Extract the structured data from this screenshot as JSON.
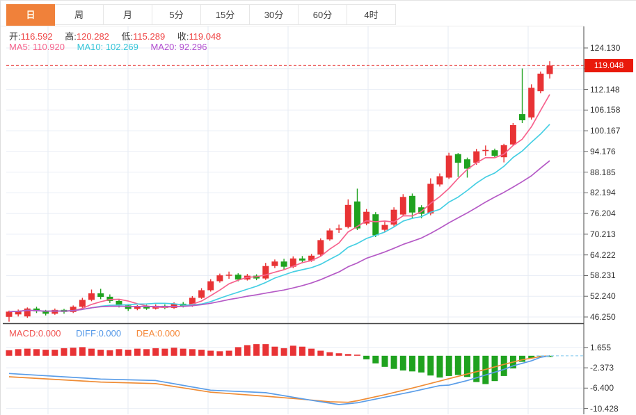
{
  "tabs": [
    {
      "label": "日",
      "active": true
    },
    {
      "label": "周",
      "active": false
    },
    {
      "label": "月",
      "active": false
    },
    {
      "label": "5分",
      "active": false
    },
    {
      "label": "15分",
      "active": false
    },
    {
      "label": "30分",
      "active": false
    },
    {
      "label": "60分",
      "active": false
    },
    {
      "label": "4时",
      "active": false
    }
  ],
  "ohlc": {
    "open_label": "开:",
    "open": "116.592",
    "high_label": "高:",
    "high": "120.282",
    "low_label": "低:",
    "low": "115.289",
    "close_label": "收:",
    "close": "119.048"
  },
  "ma_header": {
    "ma5_label": "MA5:",
    "ma5": "110.920",
    "ma10_label": "MA10:",
    "ma10": "102.269",
    "ma20_label": "MA20:",
    "ma20": "92.296"
  },
  "macd_header": {
    "macd_label": "MACD:",
    "macd": "0.000",
    "diff_label": "DIFF:",
    "diff": "0.000",
    "dea_label": "DEA:",
    "dea": "0.000"
  },
  "price_axis": {
    "tick_labels": [
      "124.130",
      "112.148",
      "106.158",
      "100.167",
      "94.176",
      "88.185",
      "82.194",
      "76.204",
      "70.213",
      "64.222",
      "58.231",
      "52.240",
      "46.250"
    ],
    "gridline_values": [
      124.13,
      118.139,
      112.148,
      106.158,
      100.167,
      94.176,
      88.185,
      82.194,
      76.204,
      70.213,
      64.222,
      58.231,
      52.24,
      46.25
    ],
    "current_price": "119.048",
    "current_price_value": 119.048
  },
  "macd_axis": {
    "tick_labels": [
      "1.655",
      "-2.373",
      "-6.400",
      "-10.428"
    ],
    "tick_values": [
      1.655,
      -2.373,
      -6.4,
      -10.428
    ]
  },
  "colors": {
    "up": "#e83335",
    "down": "#1fa21f",
    "badge": "#e9190b",
    "tab_active": "#f0813a",
    "ma5": "#f7638e",
    "ma10": "#46cfe3",
    "ma20": "#b55ac6",
    "diff": "#5a9de8",
    "dea": "#ef8c35",
    "grid": "#e9eef6",
    "vgrid": "#e6ebf3",
    "axis": "#666666",
    "separator": "#444444",
    "zero_dash": "#9fd5f2",
    "price_dash": "#e84040"
  },
  "chart_data": {
    "type": "candlestick",
    "title": "Daily candlestick chart with MA5/MA10/MA20 overlays and MACD sub-panel",
    "price_range": [
      46.25,
      124.13
    ],
    "macd_range": [
      -10.428,
      1.655
    ],
    "legend": [
      "MA5",
      "MA10",
      "MA20",
      "MACD",
      "DIFF",
      "DEA"
    ],
    "candles_format": [
      "open",
      "close",
      "low",
      "high"
    ],
    "candles": [
      [
        46.3,
        47.8,
        44.9,
        48.1
      ],
      [
        47.0,
        48.0,
        46.4,
        48.4
      ],
      [
        46.4,
        48.7,
        46.0,
        49.0
      ],
      [
        48.7,
        47.9,
        47.4,
        49.2
      ],
      [
        47.9,
        47.2,
        46.7,
        48.3
      ],
      [
        47.2,
        48.3,
        46.9,
        48.7
      ],
      [
        48.3,
        47.7,
        47.2,
        48.6
      ],
      [
        47.7,
        49.2,
        47.4,
        49.6
      ],
      [
        49.2,
        51.2,
        48.9,
        51.8
      ],
      [
        51.2,
        53.1,
        50.8,
        54.2
      ],
      [
        53.1,
        52.1,
        51.4,
        54.4
      ],
      [
        52.1,
        50.9,
        50.3,
        52.8
      ],
      [
        50.9,
        49.6,
        49.0,
        51.3
      ],
      [
        49.6,
        48.6,
        48.0,
        50.0
      ],
      [
        48.6,
        49.3,
        48.2,
        49.7
      ],
      [
        49.3,
        48.7,
        48.3,
        49.8
      ],
      [
        48.7,
        49.5,
        48.4,
        49.9
      ],
      [
        49.5,
        48.9,
        48.5,
        49.9
      ],
      [
        48.9,
        50.1,
        48.6,
        50.5
      ],
      [
        50.1,
        49.5,
        49.0,
        50.6
      ],
      [
        49.5,
        51.8,
        49.2,
        52.3
      ],
      [
        51.8,
        54.0,
        51.5,
        54.6
      ],
      [
        54.0,
        56.6,
        53.6,
        57.2
      ],
      [
        56.6,
        58.3,
        56.2,
        58.8
      ],
      [
        58.3,
        58.5,
        57.3,
        59.4
      ],
      [
        58.5,
        57.1,
        56.6,
        58.9
      ],
      [
        57.1,
        58.2,
        56.8,
        58.7
      ],
      [
        58.2,
        57.4,
        56.9,
        58.6
      ],
      [
        57.4,
        61.0,
        57.0,
        61.9
      ],
      [
        61.0,
        62.3,
        60.4,
        62.9
      ],
      [
        62.3,
        60.8,
        60.0,
        63.1
      ],
      [
        60.8,
        63.2,
        60.4,
        63.8
      ],
      [
        63.2,
        62.6,
        61.8,
        63.9
      ],
      [
        62.6,
        64.0,
        62.2,
        64.5
      ],
      [
        64.3,
        68.5,
        63.9,
        69.0
      ],
      [
        68.7,
        71.3,
        68.3,
        71.9
      ],
      [
        71.5,
        71.9,
        70.6,
        73.0
      ],
      [
        72.3,
        78.7,
        71.9,
        80.3
      ],
      [
        79.7,
        71.9,
        71.4,
        83.4
      ],
      [
        73.3,
        76.7,
        72.8,
        77.5
      ],
      [
        76.0,
        69.9,
        69.4,
        76.6
      ],
      [
        71.5,
        72.9,
        70.7,
        73.8
      ],
      [
        73.0,
        77.3,
        72.5,
        78.0
      ],
      [
        75.9,
        81.0,
        75.4,
        81.8
      ],
      [
        81.3,
        76.5,
        74.8,
        82.0
      ],
      [
        78.0,
        76.1,
        74.8,
        78.6
      ],
      [
        76.2,
        84.8,
        75.7,
        86.4
      ],
      [
        84.6,
        87.0,
        84.0,
        87.8
      ],
      [
        86.6,
        93.0,
        86.2,
        93.8
      ],
      [
        93.4,
        90.9,
        86.8,
        93.7
      ],
      [
        91.9,
        89.2,
        86.6,
        92.4
      ],
      [
        90.9,
        94.2,
        90.3,
        94.9
      ],
      [
        94.4,
        94.6,
        92.9,
        95.9
      ],
      [
        94.5,
        92.9,
        92.3,
        95.0
      ],
      [
        92.5,
        96.0,
        91.0,
        96.4
      ],
      [
        96.2,
        101.8,
        95.8,
        102.4
      ],
      [
        105.0,
        103.2,
        102.4,
        118.2
      ],
      [
        104.0,
        112.6,
        103.4,
        113.6
      ],
      [
        111.6,
        116.7,
        111.0,
        117.3
      ],
      [
        116.592,
        119.048,
        115.289,
        120.282
      ]
    ],
    "ma_periods": [
      5,
      10,
      20
    ],
    "macd_histogram": [
      1.1,
      1.3,
      1.4,
      1.3,
      1.2,
      1.2,
      1.5,
      1.6,
      1.7,
      1.4,
      1.2,
      1.1,
      1.3,
      1.2,
      1.4,
      1.3,
      1.5,
      1.4,
      1.6,
      1.4,
      1.3,
      1.2,
      1.0,
      0.9,
      1.0,
      1.7,
      2.1,
      2.3,
      2.3,
      1.8,
      1.5,
      2.0,
      1.8,
      1.4,
      1.0,
      0.7,
      0.5,
      0.35,
      0.2,
      -0.7,
      -1.5,
      -2.2,
      -2.6,
      -2.9,
      -3.1,
      -3.3,
      -3.9,
      -4.3,
      -4.0,
      -3.8,
      -4.2,
      -5.2,
      -5.6,
      -5.0,
      -4.0,
      -2.5,
      -1.2,
      -0.5,
      -0.2,
      -0.05
    ],
    "diff_line": [
      [
        0,
        -3.5
      ],
      [
        10,
        -4.6
      ],
      [
        16,
        -4.9
      ],
      [
        22,
        -6.8
      ],
      [
        28,
        -7.3
      ],
      [
        33,
        -8.8
      ],
      [
        36,
        -9.65
      ],
      [
        38,
        -9.3
      ],
      [
        41,
        -8.2
      ],
      [
        44,
        -7.1
      ],
      [
        47,
        -5.9
      ],
      [
        48,
        -5.8
      ],
      [
        50,
        -4.9
      ],
      [
        52,
        -3.8
      ],
      [
        54,
        -2.7
      ],
      [
        55,
        -2.0
      ],
      [
        57,
        -1.0
      ],
      [
        58,
        -0.3
      ],
      [
        59,
        0
      ]
    ],
    "dea_line": [
      [
        0,
        -4.15
      ],
      [
        10,
        -5.2
      ],
      [
        16,
        -5.5
      ],
      [
        22,
        -7.2
      ],
      [
        28,
        -8.0
      ],
      [
        32,
        -8.6
      ],
      [
        35,
        -9.1
      ],
      [
        37,
        -9.2
      ],
      [
        38,
        -8.9
      ],
      [
        41,
        -7.7
      ],
      [
        44,
        -6.4
      ],
      [
        47,
        -5.0
      ],
      [
        50,
        -3.6
      ],
      [
        52,
        -2.7
      ],
      [
        54,
        -1.7
      ],
      [
        56,
        -0.8
      ],
      [
        58,
        -0.15
      ],
      [
        59,
        0
      ]
    ]
  }
}
